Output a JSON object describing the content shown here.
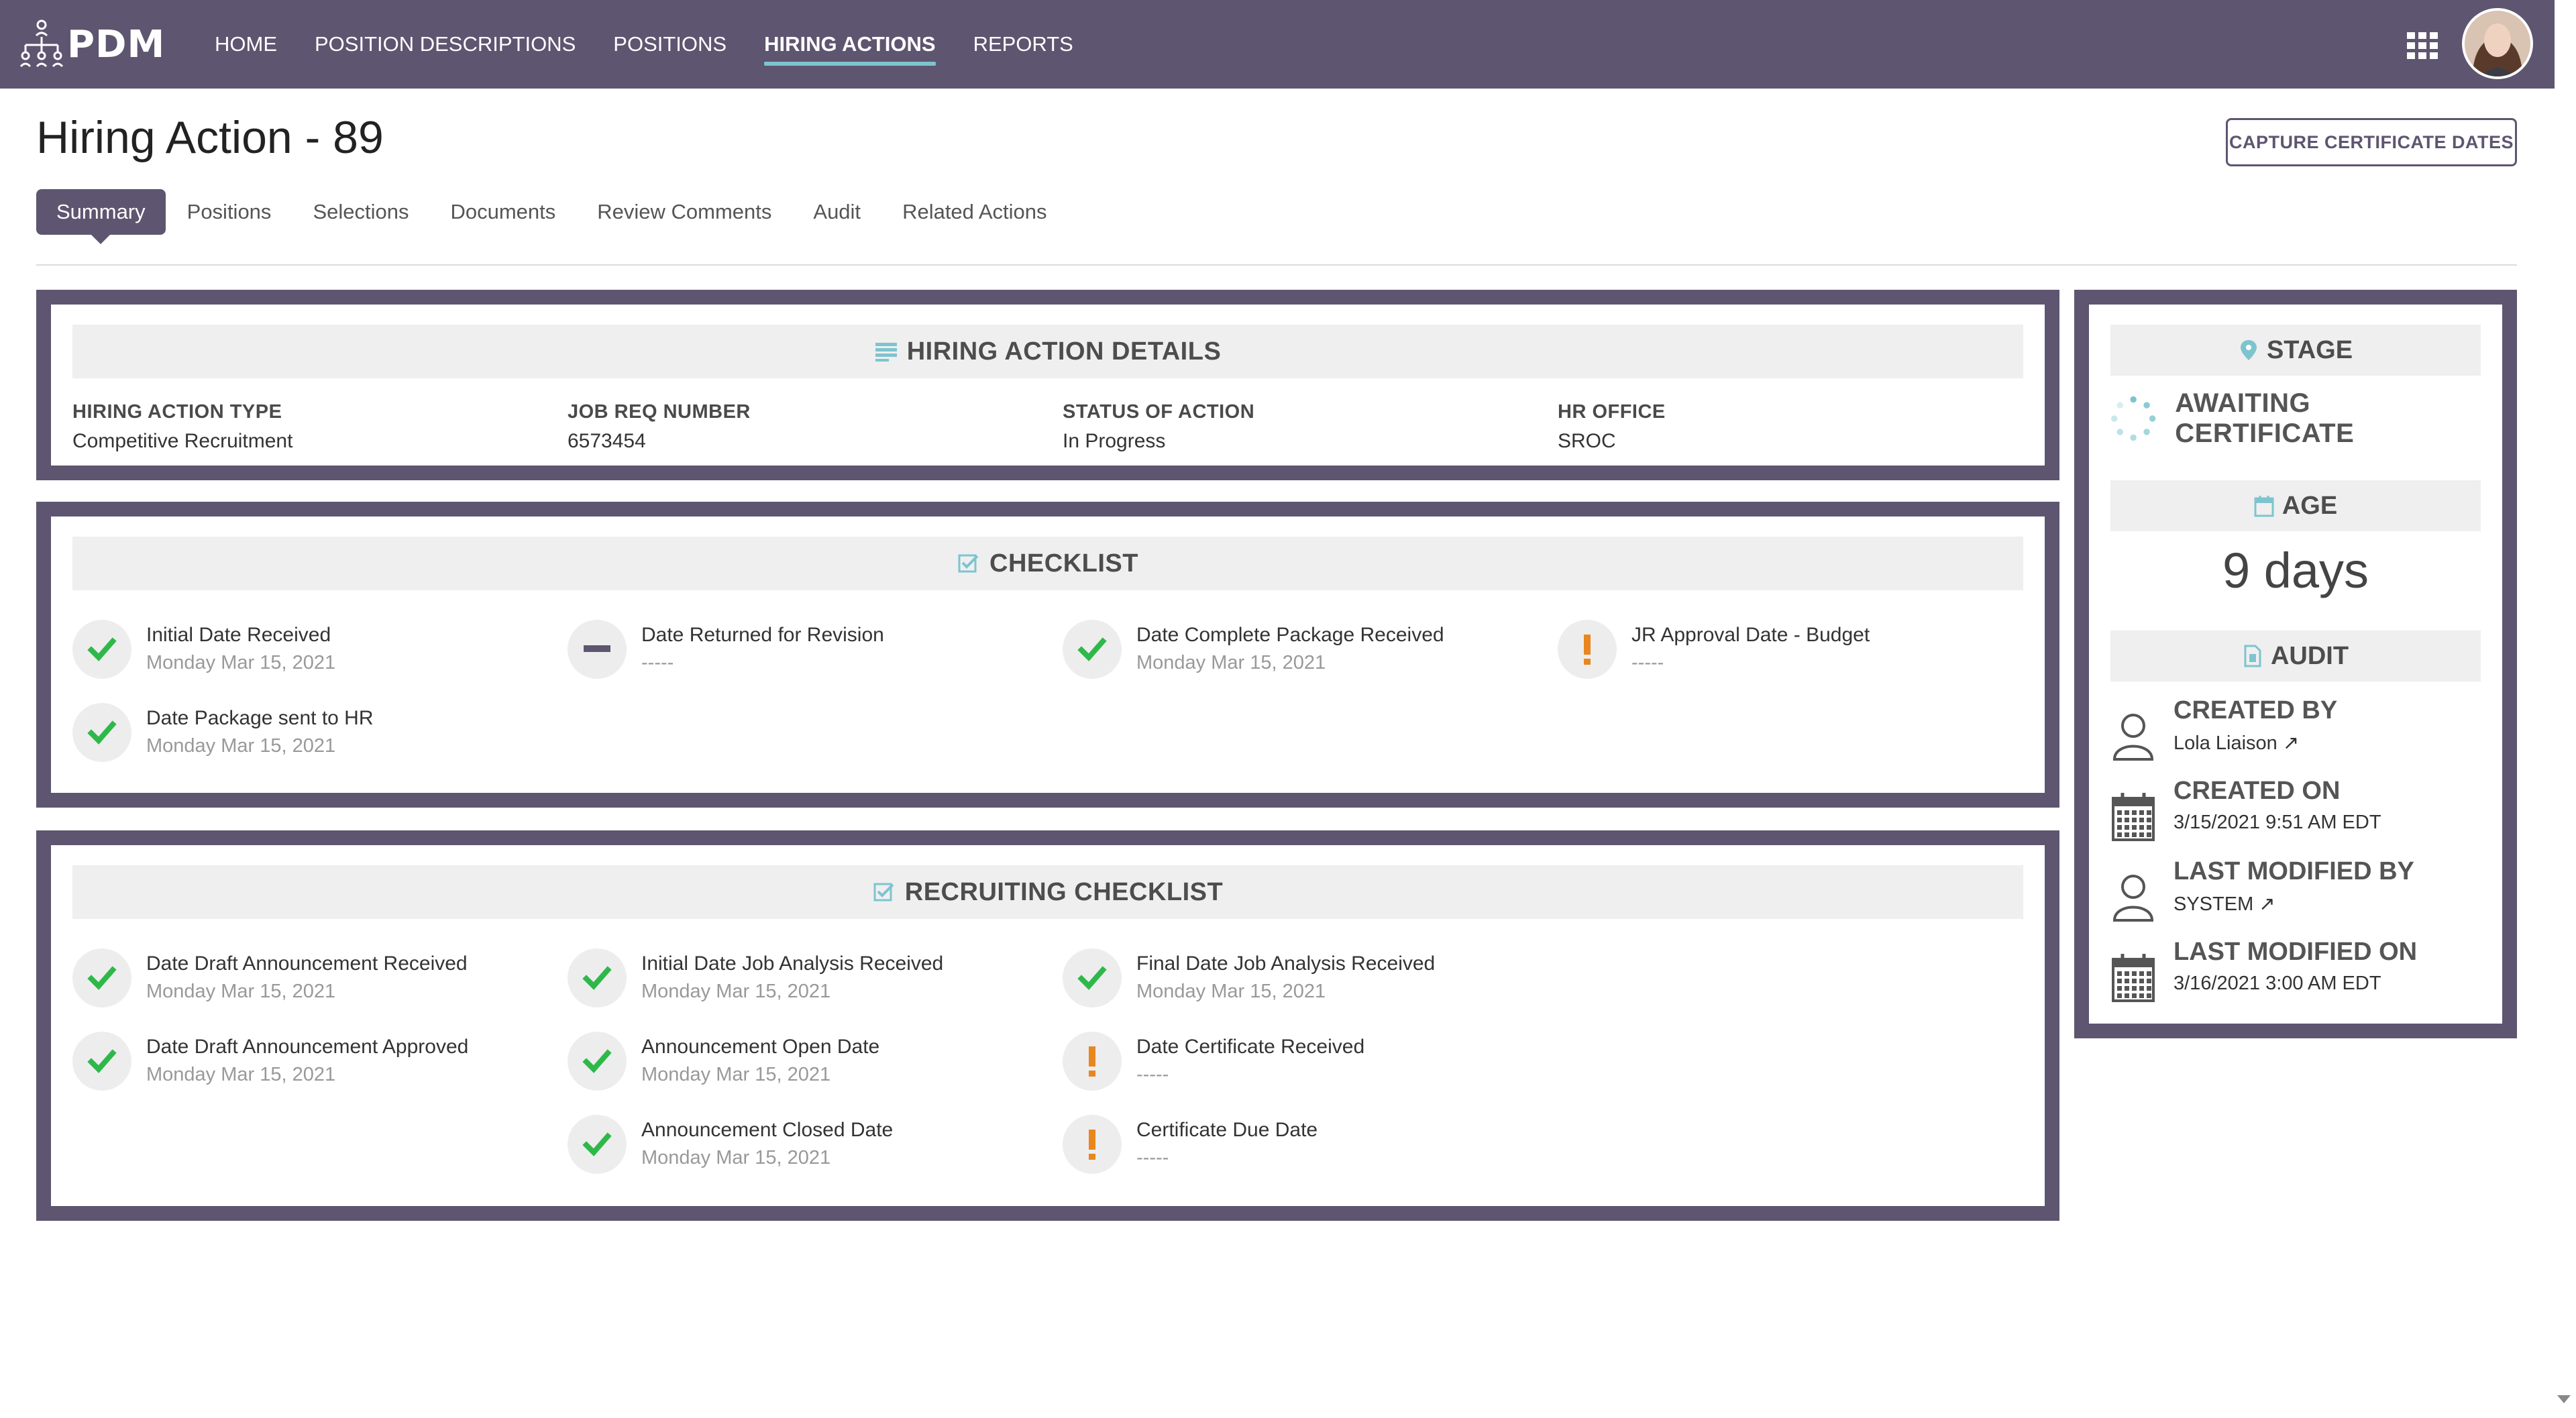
{
  "nav": {
    "logo": "PDM",
    "links": [
      "HOME",
      "POSITION DESCRIPTIONS",
      "POSITIONS",
      "HIRING ACTIONS",
      "REPORTS"
    ],
    "active": "HIRING ACTIONS",
    "accent": "#7ec4cf",
    "bar_color": "#5e5570"
  },
  "page": {
    "title": "Hiring Action - 89",
    "capture_button": "CAPTURE CERTIFICATE DATES",
    "tabs": [
      "Summary",
      "Positions",
      "Selections",
      "Documents",
      "Review Comments",
      "Audit",
      "Related Actions"
    ]
  },
  "details": {
    "heading": "HIRING ACTION DETAILS",
    "fields": [
      {
        "label": "HIRING ACTION TYPE",
        "value": "Competitive Recruitment"
      },
      {
        "label": "JOB REQ NUMBER",
        "value": "6573454"
      },
      {
        "label": "STATUS OF ACTION",
        "value": "In Progress"
      },
      {
        "label": "HR OFFICE",
        "value": "SROC"
      }
    ]
  },
  "checklist": {
    "heading": "CHECKLIST",
    "items": [
      {
        "title": "Initial Date Received",
        "date": "Monday Mar 15, 2021",
        "status": "done"
      },
      {
        "title": "Date Returned for Revision",
        "date": "-----",
        "status": "na"
      },
      {
        "title": "Date Complete Package Received",
        "date": "Monday Mar 15, 2021",
        "status": "done"
      },
      {
        "title": "JR Approval Date - Budget",
        "date": "-----",
        "status": "warn"
      },
      {
        "title": "Date Package sent to HR",
        "date": "Monday Mar 15, 2021",
        "status": "done"
      }
    ]
  },
  "recruiting": {
    "heading": "RECRUITING CHECKLIST",
    "items": [
      {
        "title": "Date Draft Announcement Received",
        "date": "Monday Mar 15, 2021",
        "status": "done"
      },
      {
        "title": "Initial Date Job Analysis Received",
        "date": "Monday Mar 15, 2021",
        "status": "done"
      },
      {
        "title": "Final Date Job Analysis Received",
        "date": "Monday Mar 15, 2021",
        "status": "done"
      },
      {
        "title": "Date Draft Announcement Approved",
        "date": "Monday Mar 15, 2021",
        "status": "done"
      },
      {
        "title": "Announcement Open Date",
        "date": "Monday Mar 15, 2021",
        "status": "done"
      },
      {
        "title": "Date Certificate Received",
        "date": "-----",
        "status": "warn"
      },
      {
        "title": "Announcement Closed Date",
        "date": "Monday Mar 15, 2021",
        "status": "done"
      },
      {
        "title": "Certificate Due Date",
        "date": "-----",
        "status": "warn"
      }
    ]
  },
  "side": {
    "stage_heading": "STAGE",
    "stage_value": "AWAITING CERTIFICATE",
    "age_heading": "AGE",
    "age_value": "9 days",
    "audit_heading": "AUDIT",
    "audit": [
      {
        "label": "CREATED BY",
        "value": "Lola Liaison ↗",
        "icon": "user-icon"
      },
      {
        "label": "CREATED ON",
        "value": "3/15/2021 9:51 AM EDT",
        "icon": "calendar-icon"
      },
      {
        "label": "LAST MODIFIED BY",
        "value": "SYSTEM ↗",
        "icon": "user-icon"
      },
      {
        "label": "LAST MODIFIED ON",
        "value": "3/16/2021 3:00 AM EDT",
        "icon": "calendar-icon"
      }
    ]
  },
  "colors": {
    "check_green": "#2fb84a",
    "warn_orange": "#e8871e",
    "na_gray": "#5e5570"
  }
}
